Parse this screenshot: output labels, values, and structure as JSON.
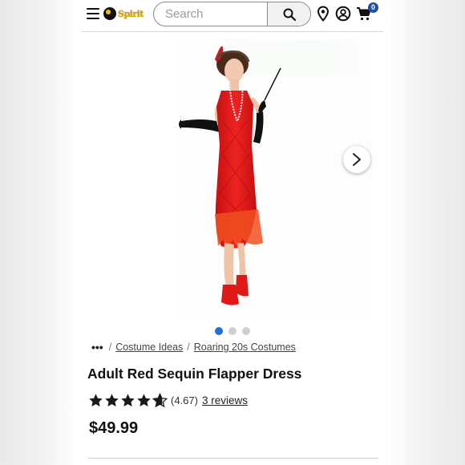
{
  "header": {
    "brand": "Spirit",
    "search": {
      "placeholder": "Search",
      "value": ""
    },
    "cart_count": "0"
  },
  "gallery": {
    "total_images": 3,
    "active_index": 0
  },
  "breadcrumb": {
    "more": "•••",
    "items": [
      "Costume Ideas",
      "Roaring 20s Costumes"
    ]
  },
  "product": {
    "title": "Adult Red Sequin Flapper Dress",
    "rating_value": 4.67,
    "rating_text": "(4.67)",
    "reviews": "3 reviews",
    "price": "$49.99"
  },
  "colors": {
    "dress": "#e21b1b",
    "active_dot": "#1e6fd9",
    "badge": "#1e4ea8"
  }
}
